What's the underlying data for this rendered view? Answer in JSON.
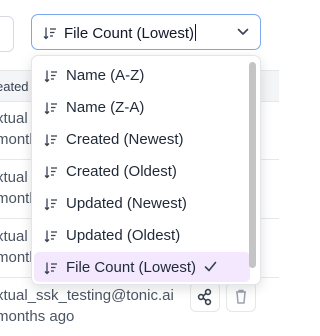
{
  "background": {
    "header_label": "eated",
    "rows": [
      {
        "line1": "xtual",
        "line2": "month"
      },
      {
        "line1": "xtual",
        "line2": "month"
      },
      {
        "line1": "xtual",
        "line2": "month"
      },
      {
        "line1": "xtual_ssk_testing@tonic.ai",
        "line2": "months ago"
      }
    ]
  },
  "sort_select": {
    "value": "File Count (Lowest)",
    "icon": "sort-icon",
    "chevron": "chevron-down-icon"
  },
  "dropdown": {
    "options": [
      {
        "label": "Name (A-Z)"
      },
      {
        "label": "Name (Z-A)"
      },
      {
        "label": "Created (Newest)"
      },
      {
        "label": "Created (Oldest)"
      },
      {
        "label": "Updated (Newest)"
      },
      {
        "label": "Updated (Oldest)"
      },
      {
        "label": "File Count (Lowest)"
      }
    ],
    "selected_index": 6,
    "selected_bg": "#f3e8fd",
    "check_icon": "check-icon"
  },
  "colors": {
    "focus_border": "#7aa7f0",
    "row_border": "#e5e7eb"
  }
}
